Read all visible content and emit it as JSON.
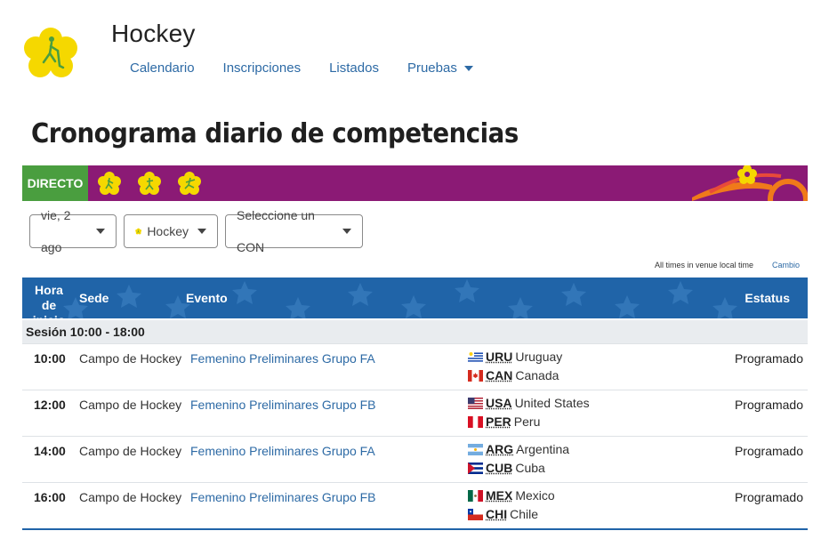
{
  "header": {
    "sport_title": "Hockey",
    "nav": [
      {
        "label": "Calendario"
      },
      {
        "label": "Inscripciones"
      },
      {
        "label": "Listados"
      },
      {
        "label": "Pruebas"
      }
    ]
  },
  "page_title": "Cronograma diario de competencias",
  "banner": {
    "live_label": "DIRECTO",
    "accent": "#8b1a75",
    "live_color": "#4a9e3f"
  },
  "filters": {
    "date": "vie, 2 ago",
    "sport": "Hockey",
    "noc": "Seleccione un CON"
  },
  "timezone_note": "All times in venue local time",
  "timezone_link": "Cambio",
  "table": {
    "columns": {
      "start": "Hora de inicio",
      "venue": "Sede",
      "event": "Evento",
      "status": "Estatus"
    },
    "session_label": "Sesión  10:00 - 18:00",
    "rows": [
      {
        "time": "10:00",
        "venue": "Campo de Hockey",
        "event": "Femenino Preliminares Grupo FA",
        "team1": {
          "code": "URU",
          "name": "Uruguay"
        },
        "team2": {
          "code": "CAN",
          "name": "Canada"
        },
        "status": "Programado"
      },
      {
        "time": "12:00",
        "venue": "Campo de Hockey",
        "event": "Femenino Preliminares Grupo FB",
        "team1": {
          "code": "USA",
          "name": "United States"
        },
        "team2": {
          "code": "PER",
          "name": "Peru"
        },
        "status": "Programado"
      },
      {
        "time": "14:00",
        "venue": "Campo de Hockey",
        "event": "Femenino Preliminares Grupo FA",
        "team1": {
          "code": "ARG",
          "name": "Argentina"
        },
        "team2": {
          "code": "CUB",
          "name": "Cuba"
        },
        "status": "Programado"
      },
      {
        "time": "16:00",
        "venue": "Campo de Hockey",
        "event": "Femenino Preliminares Grupo FB",
        "team1": {
          "code": "MEX",
          "name": "Mexico"
        },
        "team2": {
          "code": "CHI",
          "name": "Chile"
        },
        "status": "Programado"
      }
    ]
  }
}
